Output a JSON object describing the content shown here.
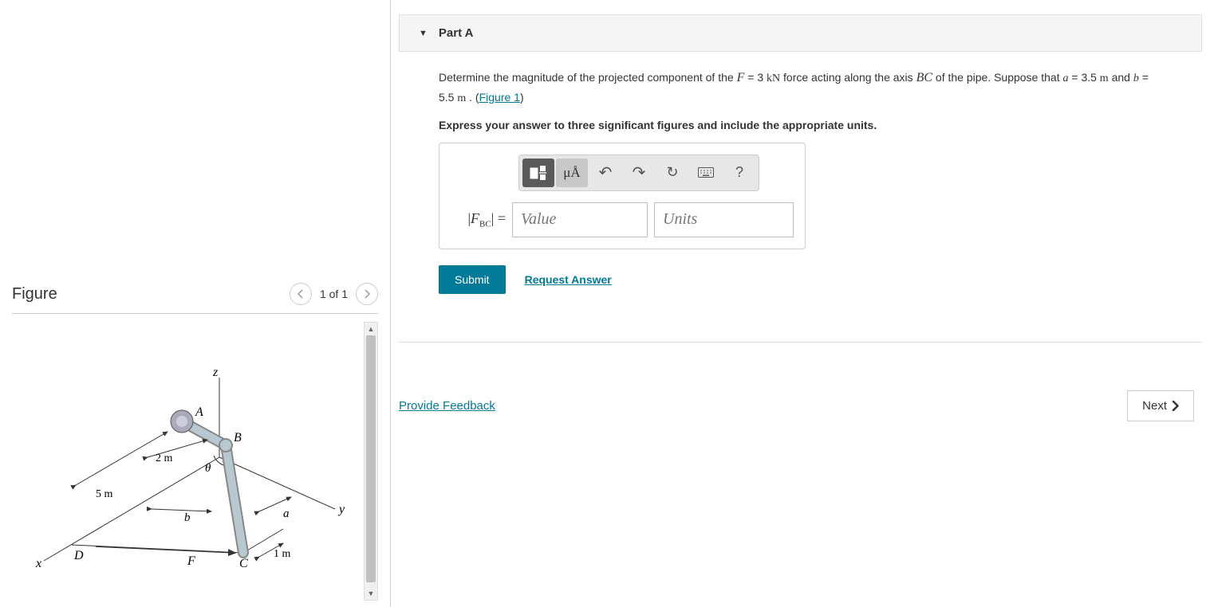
{
  "figure": {
    "title": "Figure",
    "pager": "1 of 1",
    "labels": {
      "z": "z",
      "y": "y",
      "x": "x",
      "A": "A",
      "B": "B",
      "C": "C",
      "D": "D",
      "F": "F",
      "theta": "θ",
      "a": "a",
      "b": "b",
      "d5m": "5 m",
      "d2m": "2 m",
      "d1m": "1 m"
    }
  },
  "part": {
    "title": "Part A",
    "problem": {
      "t1": "Determine the magnitude of the projected component of the ",
      "F": "F",
      "eq1": " = 3 ",
      "unitF": "kN",
      "t2": " force acting along the axis ",
      "BC": "BC",
      "t3": " of the pipe. Suppose that ",
      "a": "a",
      "eqa": " = 3.5 ",
      "ma": "m",
      "and": " and ",
      "b": "b",
      "eqb": " = 5.5 ",
      "mb": "m",
      "t4": " . (",
      "figlink": "Figure 1",
      "t5": ")"
    },
    "instruction": "Express your answer to three significant figures and include the appropriate units.",
    "toolbar": {
      "units": "μÅ",
      "undo": "↶",
      "redo": "↷",
      "reset": "↻",
      "help": "?"
    },
    "answer": {
      "label_open": "|",
      "label_var": "F",
      "label_sub": "BC",
      "label_close": "| =",
      "value_ph": "Value",
      "units_ph": "Units"
    },
    "submit": "Submit",
    "request": "Request Answer"
  },
  "footer": {
    "feedback": "Provide Feedback",
    "next": "Next"
  }
}
